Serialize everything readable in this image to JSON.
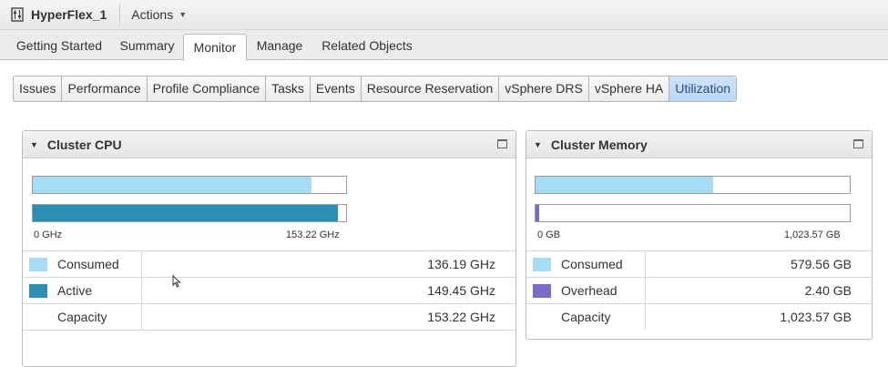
{
  "header": {
    "title": "HyperFlex_1",
    "actions_label": "Actions",
    "host_icon": "cluster-icon"
  },
  "main_tabs": [
    {
      "label": "Getting Started",
      "active": false
    },
    {
      "label": "Summary",
      "active": false
    },
    {
      "label": "Monitor",
      "active": true
    },
    {
      "label": "Manage",
      "active": false
    },
    {
      "label": "Related Objects",
      "active": false
    }
  ],
  "sub_tabs": [
    {
      "label": "Issues",
      "active": false
    },
    {
      "label": "Performance",
      "active": false
    },
    {
      "label": "Profile Compliance",
      "active": false
    },
    {
      "label": "Tasks",
      "active": false
    },
    {
      "label": "Events",
      "active": false
    },
    {
      "label": "Resource Reservation",
      "active": false
    },
    {
      "label": "vSphere DRS",
      "active": false
    },
    {
      "label": "vSphere HA",
      "active": false
    },
    {
      "label": "Utilization",
      "active": true
    }
  ],
  "cpu": {
    "title": "Cluster CPU",
    "scale_min": "0 GHz",
    "scale_max": "153.22 GHz",
    "consumed_fraction": 0.889,
    "active_fraction": 0.975,
    "rows": [
      {
        "label": "Consumed",
        "value": "136.19 GHz",
        "color": "#a5ddf6"
      },
      {
        "label": "Active",
        "value": "149.45 GHz",
        "color": "#2b8fb3"
      },
      {
        "label": "Capacity",
        "value": "153.22 GHz",
        "color": ""
      }
    ]
  },
  "memory": {
    "title": "Cluster Memory",
    "scale_min": "0 GB",
    "scale_max": "1,023.57 GB",
    "consumed_fraction": 0.566,
    "overhead_fraction": 0.012,
    "rows": [
      {
        "label": "Consumed",
        "value": "579.56 GB",
        "color": "#a5ddf6"
      },
      {
        "label": "Overhead",
        "value": "2.40 GB",
        "color": "#7d6bc8"
      },
      {
        "label": "Capacity",
        "value": "1,023.57 GB",
        "color": ""
      }
    ]
  },
  "colors": {
    "consumed": "#a5ddf6",
    "active": "#2b8fb3",
    "overhead": "#7d6bc8",
    "tab_active_bg": "#c4dcf8"
  }
}
